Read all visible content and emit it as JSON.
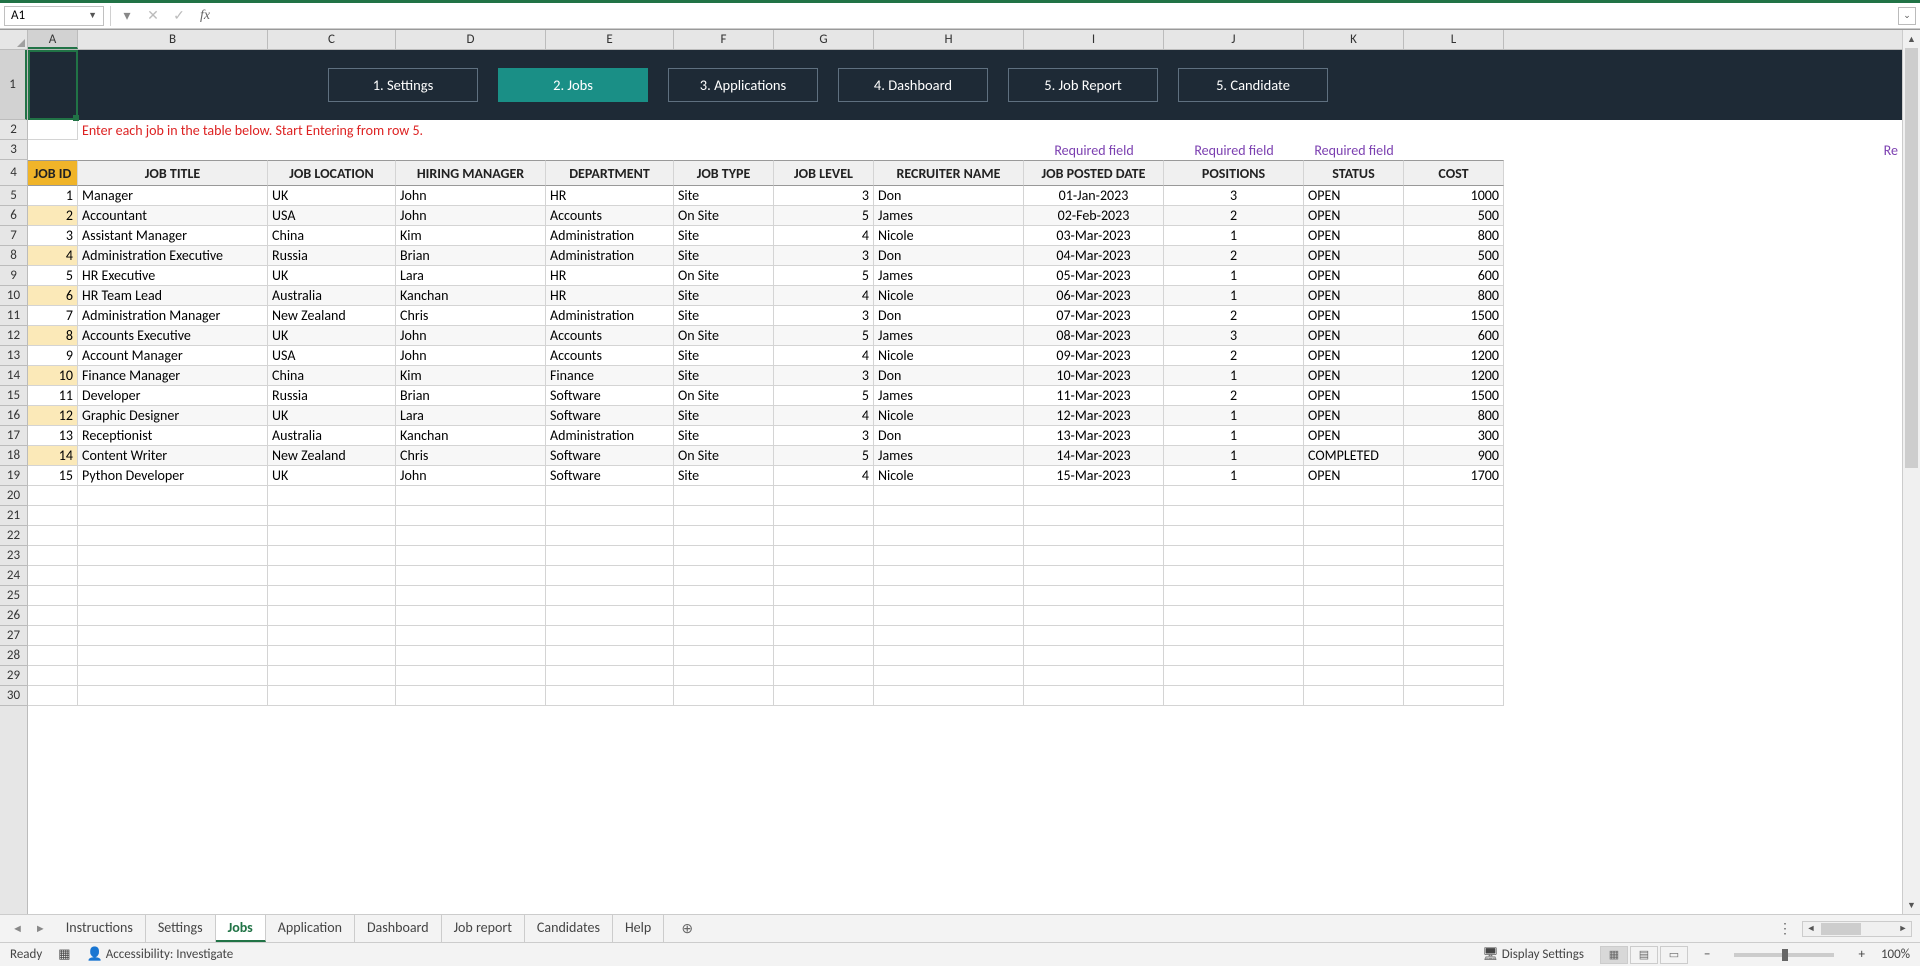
{
  "namebox": "A1",
  "nav_buttons": [
    "1. Settings",
    "2. Jobs",
    "3. Applications",
    "4. Dashboard",
    "5. Job Report",
    "5. Candidate"
  ],
  "nav_active_index": 1,
  "instruction": "Enter each job in the table below. Start Entering from row 5.",
  "required_label": "Required field",
  "required_overflow": "Re",
  "columns": [
    "A",
    "B",
    "C",
    "D",
    "E",
    "F",
    "G",
    "H",
    "I",
    "J",
    "K",
    "L"
  ],
  "headers": [
    "JOB ID",
    "JOB TITLE",
    "JOB LOCATION",
    "HIRING MANAGER",
    "DEPARTMENT",
    "JOB TYPE",
    "JOB LEVEL",
    "RECRUITER NAME",
    "JOB POSTED DATE",
    "POSITIONS",
    "STATUS",
    "COST"
  ],
  "rows": [
    {
      "id": 1,
      "title": "Manager",
      "loc": "UK",
      "mgr": "John",
      "dept": "HR",
      "type": "Site",
      "level": 3,
      "recruiter": "Don",
      "date": "01-Jan-2023",
      "pos": 3,
      "status": "OPEN",
      "cost": 1000
    },
    {
      "id": 2,
      "title": "Accountant",
      "loc": "USA",
      "mgr": "John",
      "dept": "Accounts",
      "type": "On Site",
      "level": 5,
      "recruiter": "James",
      "date": "02-Feb-2023",
      "pos": 2,
      "status": "OPEN",
      "cost": 500
    },
    {
      "id": 3,
      "title": "Assistant Manager",
      "loc": "China",
      "mgr": "Kim",
      "dept": "Administration",
      "type": "Site",
      "level": 4,
      "recruiter": "Nicole",
      "date": "03-Mar-2023",
      "pos": 1,
      "status": "OPEN",
      "cost": 800
    },
    {
      "id": 4,
      "title": "Administration Executive",
      "loc": "Russia",
      "mgr": "Brian",
      "dept": "Administration",
      "type": "Site",
      "level": 3,
      "recruiter": "Don",
      "date": "04-Mar-2023",
      "pos": 2,
      "status": "OPEN",
      "cost": 500
    },
    {
      "id": 5,
      "title": "HR Executive",
      "loc": "UK",
      "mgr": "Lara",
      "dept": "HR",
      "type": "On Site",
      "level": 5,
      "recruiter": "James",
      "date": "05-Mar-2023",
      "pos": 1,
      "status": "OPEN",
      "cost": 600
    },
    {
      "id": 6,
      "title": "HR Team Lead",
      "loc": "Australia",
      "mgr": "Kanchan",
      "dept": "HR",
      "type": "Site",
      "level": 4,
      "recruiter": "Nicole",
      "date": "06-Mar-2023",
      "pos": 1,
      "status": "OPEN",
      "cost": 800
    },
    {
      "id": 7,
      "title": "Administration Manager",
      "loc": "New Zealand",
      "mgr": "Chris",
      "dept": "Administration",
      "type": "Site",
      "level": 3,
      "recruiter": "Don",
      "date": "07-Mar-2023",
      "pos": 2,
      "status": "OPEN",
      "cost": 1500
    },
    {
      "id": 8,
      "title": "Accounts Executive",
      "loc": "UK",
      "mgr": "John",
      "dept": "Accounts",
      "type": "On Site",
      "level": 5,
      "recruiter": "James",
      "date": "08-Mar-2023",
      "pos": 3,
      "status": "OPEN",
      "cost": 600
    },
    {
      "id": 9,
      "title": "Account Manager",
      "loc": "USA",
      "mgr": "John",
      "dept": "Accounts",
      "type": "Site",
      "level": 4,
      "recruiter": "Nicole",
      "date": "09-Mar-2023",
      "pos": 2,
      "status": "OPEN",
      "cost": 1200
    },
    {
      "id": 10,
      "title": "Finance Manager",
      "loc": "China",
      "mgr": "Kim",
      "dept": "Finance",
      "type": "Site",
      "level": 3,
      "recruiter": "Don",
      "date": "10-Mar-2023",
      "pos": 1,
      "status": "OPEN",
      "cost": 1200
    },
    {
      "id": 11,
      "title": "Developer",
      "loc": "Russia",
      "mgr": "Brian",
      "dept": "Software",
      "type": "On Site",
      "level": 5,
      "recruiter": "James",
      "date": "11-Mar-2023",
      "pos": 2,
      "status": "OPEN",
      "cost": 1500
    },
    {
      "id": 12,
      "title": "Graphic Designer",
      "loc": "UK",
      "mgr": "Lara",
      "dept": "Software",
      "type": "Site",
      "level": 4,
      "recruiter": "Nicole",
      "date": "12-Mar-2023",
      "pos": 1,
      "status": "OPEN",
      "cost": 800
    },
    {
      "id": 13,
      "title": "Receptionist",
      "loc": "Australia",
      "mgr": "Kanchan",
      "dept": "Administration",
      "type": "Site",
      "level": 3,
      "recruiter": "Don",
      "date": "13-Mar-2023",
      "pos": 1,
      "status": "OPEN",
      "cost": 300
    },
    {
      "id": 14,
      "title": "Content Writer",
      "loc": "New Zealand",
      "mgr": "Chris",
      "dept": "Software",
      "type": "On Site",
      "level": 5,
      "recruiter": "James",
      "date": "14-Mar-2023",
      "pos": 1,
      "status": "COMPLETED",
      "cost": 900
    },
    {
      "id": 15,
      "title": "Python Developer",
      "loc": "UK",
      "mgr": "John",
      "dept": "Software",
      "type": "Site",
      "level": 4,
      "recruiter": "Nicole",
      "date": "15-Mar-2023",
      "pos": 1,
      "status": "OPEN",
      "cost": 1700
    }
  ],
  "empty_rows_start": 20,
  "empty_rows_end": 30,
  "sheet_tabs": [
    "Instructions",
    "Settings",
    "Jobs",
    "Application",
    "Dashboard",
    "Job report",
    "Candidates",
    "Help"
  ],
  "active_sheet_index": 2,
  "status": {
    "ready": "Ready",
    "accessibility": "Accessibility: Investigate",
    "display": "Display Settings",
    "zoom": "100%"
  }
}
